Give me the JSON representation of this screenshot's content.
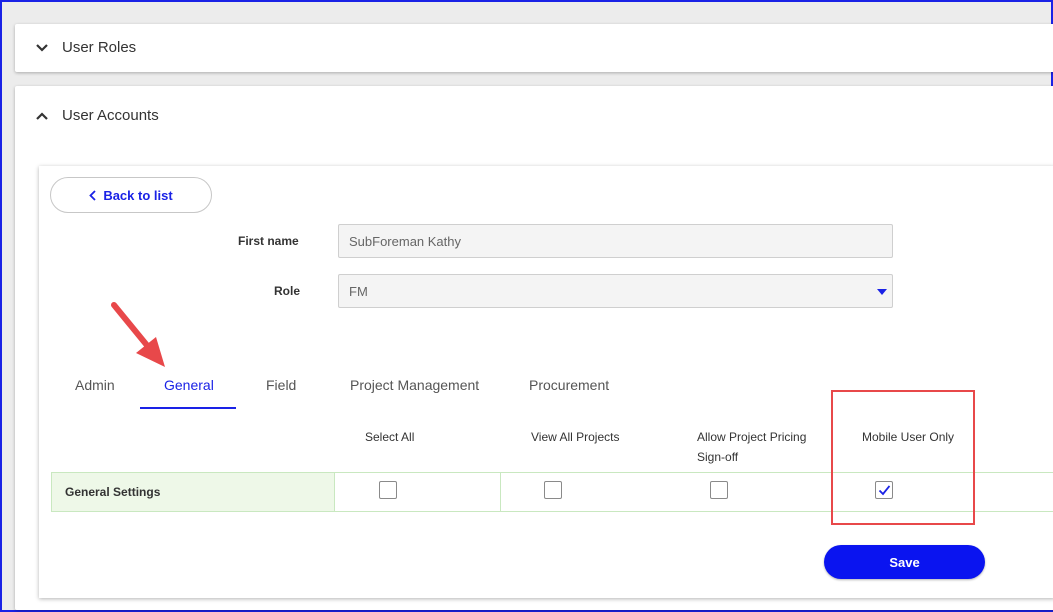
{
  "sections": {
    "user_roles": {
      "title": "User Roles",
      "icon": "chevron-down-icon"
    },
    "user_accounts": {
      "title": "User Accounts",
      "icon": "chevron-up-icon"
    }
  },
  "back_button": {
    "label": "Back to list",
    "icon": "chevron-left-icon"
  },
  "form": {
    "first_name": {
      "label": "First name",
      "value": "SubForeman Kathy"
    },
    "role": {
      "label": "Role",
      "value": "FM"
    }
  },
  "tabs": [
    {
      "label": "Admin",
      "active": false
    },
    {
      "label": "General",
      "active": true
    },
    {
      "label": "Field",
      "active": false
    },
    {
      "label": "Project Management",
      "active": false
    },
    {
      "label": "Procurement",
      "active": false
    }
  ],
  "permissions": {
    "columns": [
      {
        "label": "Select All"
      },
      {
        "label": "View All Projects"
      },
      {
        "label": "Allow Project Pricing Sign-off"
      },
      {
        "label": "Mobile User Only"
      }
    ],
    "row": {
      "label": "General Settings",
      "checked": [
        false,
        false,
        false,
        true
      ]
    }
  },
  "save_button": {
    "label": "Save"
  },
  "colors": {
    "accent": "#1a22e6",
    "save_button": "#0a14f0",
    "highlight": "#e8484a",
    "row_background": "#eef8e8"
  }
}
